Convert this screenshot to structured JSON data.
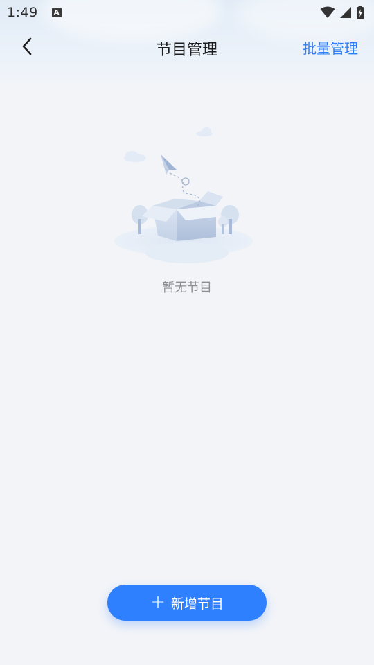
{
  "status_bar": {
    "time": "1:49",
    "icons": [
      "notification-a-icon",
      "wifi-icon",
      "signal-icon",
      "battery-icon"
    ]
  },
  "header": {
    "title": "节目管理",
    "back_icon": "chevron-left-icon",
    "batch_manage_label": "批量管理"
  },
  "empty_state": {
    "message": "暂无节目",
    "illustration": "empty-box-icon"
  },
  "actions": {
    "add_program_label": "新增节目",
    "add_icon": "plus-icon"
  },
  "colors": {
    "accent": "#2f80ff",
    "link": "#2f7ff6",
    "background": "#f2f4f8",
    "muted_text": "#8e8e93"
  }
}
